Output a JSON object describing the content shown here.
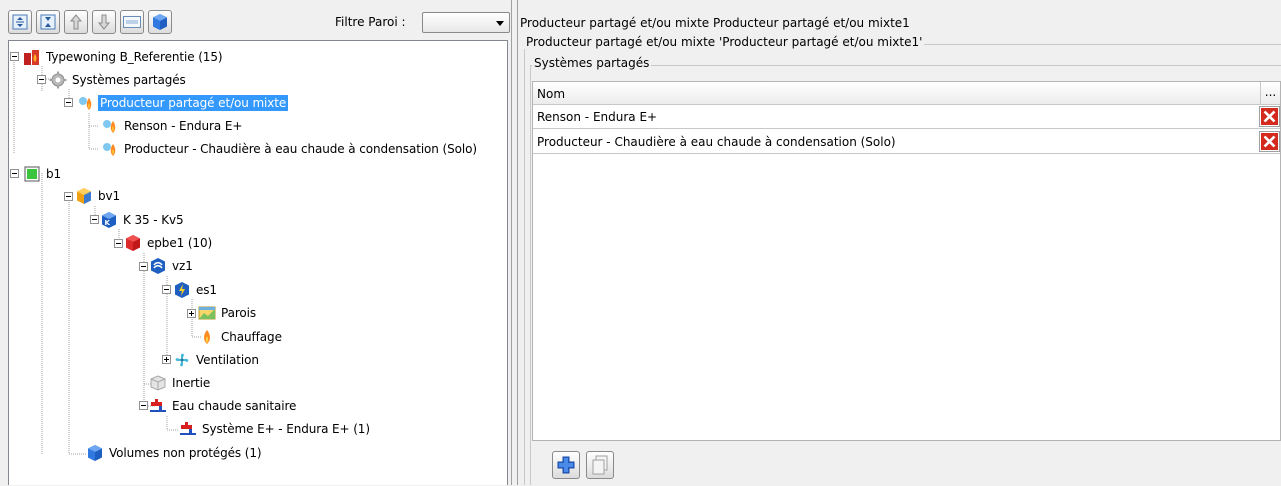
{
  "toolbar": {
    "buttons": [
      {
        "name": "expand-all-icon"
      },
      {
        "name": "collapse-all-icon"
      },
      {
        "name": "move-up-icon"
      },
      {
        "name": "move-down-icon"
      },
      {
        "name": "rename-icon"
      },
      {
        "name": "cube-icon"
      }
    ],
    "filter_label": "Filtre Paroi :",
    "filter_value": ""
  },
  "tree": {
    "items": [
      {
        "label": "Typewoning B_Referentie (15)",
        "icon": "building-fire-icon"
      },
      {
        "label": "Systèmes partagés",
        "icon": "gear-icon"
      },
      {
        "label": "Producteur partagé et/ou mixte",
        "icon": "shared-producer-icon",
        "selected": true
      },
      {
        "label": "Renson - Endura E+",
        "icon": "shared-producer-icon"
      },
      {
        "label": "Producteur - Chaudière à eau chaude à condensation (Solo)",
        "icon": "shared-producer-icon"
      },
      {
        "label": "b1",
        "icon": "green-cube-icon"
      },
      {
        "label": "bv1",
        "icon": "yellow-cube-icon"
      },
      {
        "label": "K 35 - Kv5",
        "icon": "k-cube-icon"
      },
      {
        "label": "epbe1 (10)",
        "icon": "red-cube-icon"
      },
      {
        "label": "vz1",
        "icon": "ventilation-zone-icon"
      },
      {
        "label": "es1",
        "icon": "energy-sector-icon"
      },
      {
        "label": "Parois",
        "icon": "wall-icon"
      },
      {
        "label": "Chauffage",
        "icon": "flame-icon"
      },
      {
        "label": "Ventilation",
        "icon": "fan-icon"
      },
      {
        "label": "Inertie",
        "icon": "inertia-icon"
      },
      {
        "label": "Eau chaude sanitaire",
        "icon": "faucet-icon"
      },
      {
        "label": "Système E+ - Endura E+ (1)",
        "icon": "faucet-icon"
      },
      {
        "label": "Volumes non protégés (1)",
        "icon": "blue-cube-icon"
      }
    ]
  },
  "right": {
    "title": "Producteur partagé et/ou mixte Producteur partagé et/ou mixte1",
    "group_label": "Producteur partagé et/ou mixte 'Producteur partagé et/ou mixte1'",
    "subgroup_label": "Systèmes partagés",
    "grid": {
      "header": "Nom",
      "more": "...",
      "rows": [
        {
          "name": "Renson - Endura E+"
        },
        {
          "name": "Producteur - Chaudière à eau chaude à condensation (Solo)"
        }
      ]
    }
  },
  "colors": {
    "selection": "#3399ff",
    "delete_red": "#d42a1e"
  }
}
